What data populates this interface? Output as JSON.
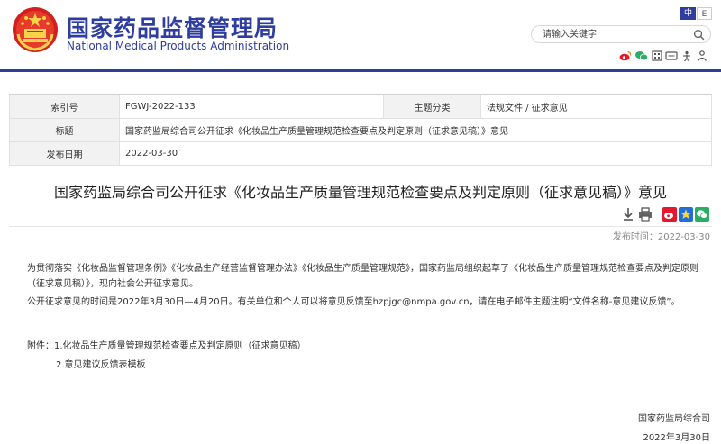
{
  "header": {
    "title_cn": "国家药品监督管理局",
    "title_en": "National Medical Products Administration",
    "lang_zh": "中",
    "lang_en": "E",
    "search_placeholder": "请输入关键字",
    "brand_color": "#2f3e9e"
  },
  "social_icons": [
    "weibo-icon",
    "wechat-icon",
    "mobile-icon",
    "accessibility-icon",
    "elder-mode-icon"
  ],
  "info": {
    "rows": [
      {
        "label1": "索引号",
        "value1": "FGWJ-2022-133",
        "label2": "主题分类",
        "value2": "法规文件 / 征求意见"
      },
      {
        "label1": "标题",
        "value1": "国家药监局综合司公开征求《化妆品生产质量管理规范检查要点及判定原则（征求意见稿）》意见"
      },
      {
        "label1": "发布日期",
        "value1": "2022-03-30"
      }
    ]
  },
  "article": {
    "title": "国家药监局综合司公开征求《化妆品生产质量管理规范检查要点及判定原则（征求意见稿）》意见",
    "pubdate": "发布时间：2022-03-30",
    "para1": "为贯彻落实《化妆品监督管理条例》《化妆品生产经营监督管理办法》《化妆品生产质量管理规范》，国家药监局组织起草了《化妆品生产质量管理规范检查要点及判定原则（征求意见稿）》，现向社会公开征求意见。",
    "para2": "公开征求意见的时间是2022年3月30日—4月20日。有关单位和个人可以将意见反馈至hzpjgc@nmpa.gov.cn，请在电子邮件主题注明“文件名称-意见建议反馈”。",
    "attach1": "附件：1.化妆品生产质量管理规范检查要点及判定原则（征求意见稿）",
    "attach2": "2.意见建议反馈表模板",
    "sign_org": "国家药监局综合司",
    "sign_date": "2022年3月30日"
  },
  "tool_icons": [
    "download-icon",
    "print-icon",
    "share-weibo-icon",
    "favorite-icon",
    "share-wechat-icon"
  ]
}
